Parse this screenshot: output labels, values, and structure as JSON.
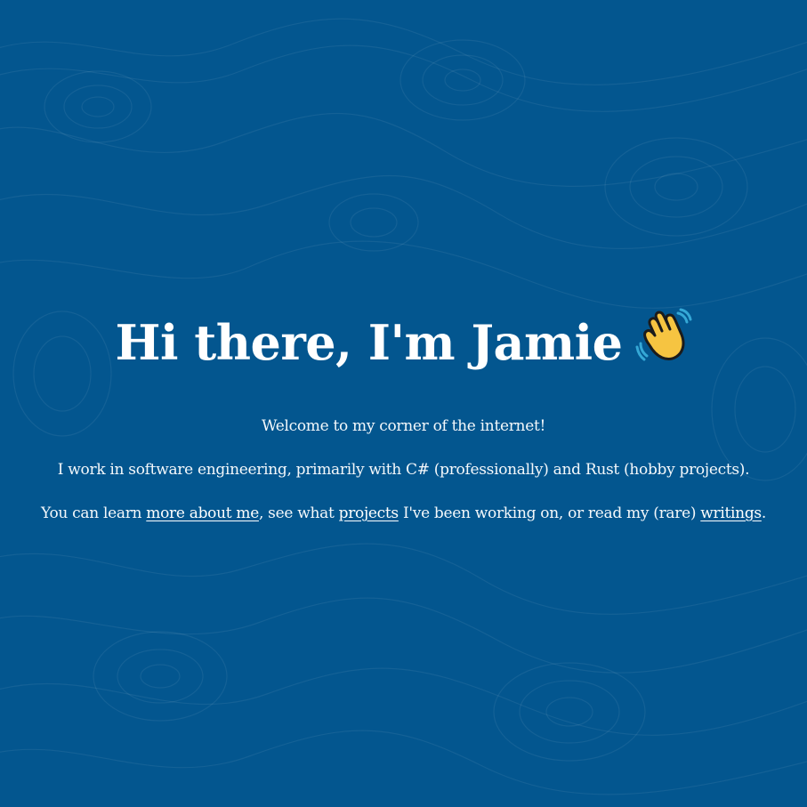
{
  "hero": {
    "title": "Hi there, I'm Jamie",
    "title_emoji": "waving-hand-icon",
    "welcome": "Welcome to my corner of the internet!",
    "work": "I work in software engineering, primarily with C# (professionally) and Rust (hobby projects).",
    "links_line": {
      "prefix": "You can learn ",
      "about_link": "more about me",
      "mid1": ", see what ",
      "projects_link": "projects",
      "mid2": " I've been working on, or read my (rare) ",
      "writings_link": "writings",
      "suffix": "."
    }
  },
  "colors": {
    "background": "#03568f",
    "text": "#ffffff",
    "emoji_yellow": "#f6c441",
    "emoji_outline": "#1b1b1b",
    "emoji_motion": "#35a8d6"
  }
}
